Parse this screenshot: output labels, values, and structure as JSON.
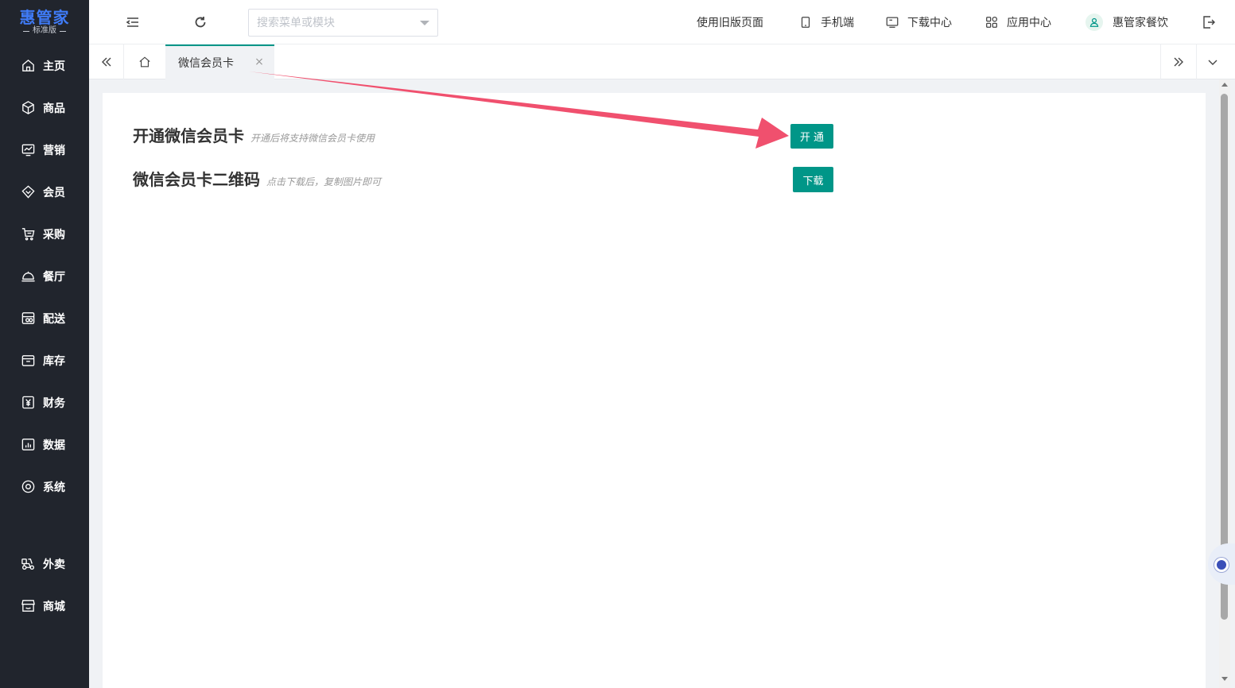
{
  "brand": {
    "name": "惠管家",
    "edition": "标准版"
  },
  "sidebar": {
    "items": [
      {
        "label": "主页",
        "icon": "home-icon"
      },
      {
        "label": "商品",
        "icon": "box-icon"
      },
      {
        "label": "营销",
        "icon": "chart-icon"
      },
      {
        "label": "会员",
        "icon": "diamond-icon"
      },
      {
        "label": "采购",
        "icon": "cart-icon"
      },
      {
        "label": "餐厅",
        "icon": "cloche-icon"
      },
      {
        "label": "配送",
        "icon": "delivery-icon"
      },
      {
        "label": "库存",
        "icon": "inventory-icon"
      },
      {
        "label": "财务",
        "icon": "yen-icon"
      },
      {
        "label": "数据",
        "icon": "data-icon"
      },
      {
        "label": "系统",
        "icon": "settings-icon"
      }
    ],
    "extra_items": [
      {
        "label": "外卖",
        "icon": "takeaway-icon"
      },
      {
        "label": "商城",
        "icon": "store-icon"
      }
    ]
  },
  "header": {
    "search_placeholder": "搜索菜单或模块",
    "old_page": "使用旧版页面",
    "mobile": "手机端",
    "download_center": "下载中心",
    "app_center": "应用中心",
    "user_name": "惠管家餐饮"
  },
  "tabs": {
    "active_label": "微信会员卡",
    "close_symbol": "×"
  },
  "content": {
    "open_card": {
      "title": "开通微信会员卡",
      "hint": "开通后将支持微信会员卡使用",
      "button": "开 通"
    },
    "qr_code": {
      "title": "微信会员卡二维码",
      "hint": "点击下载后，复制图片即可",
      "button": "下载"
    }
  },
  "colors": {
    "sidebar_bg": "#21252d",
    "brand": "#3f7bf7",
    "accent": "#009688",
    "annotation_arrow": "#f0506e"
  }
}
